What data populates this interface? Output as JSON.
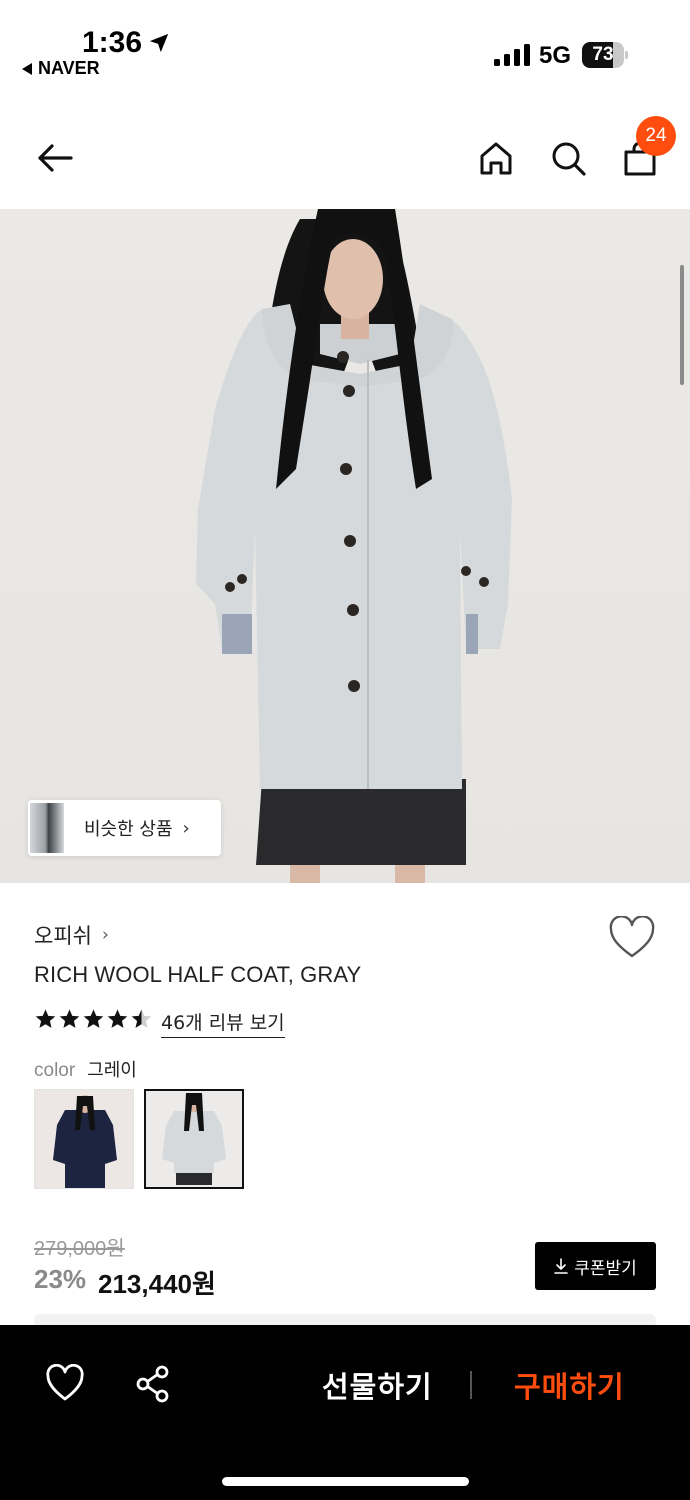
{
  "status_bar": {
    "time": "1:36",
    "back_app": "NAVER",
    "network": "5G",
    "battery": "73",
    "battery_level": 0.73
  },
  "nav": {
    "cart_count": "24"
  },
  "hero": {
    "similar_label": "비슷한 상품"
  },
  "product": {
    "brand": "오피쉬",
    "name": "RICH WOOL HALF COAT, GRAY",
    "rating": 4.5,
    "review_link": "46개 리뷰 보기",
    "color_label": "color",
    "color_value": "그레이",
    "swatch_colors": [
      "#1d2440",
      "#d6d9db"
    ]
  },
  "price": {
    "original": "279,000원",
    "discount": "23%",
    "final": "213,440원",
    "coupon_label": "쿠폰받기"
  },
  "bottom_bar": {
    "gift_label": "선물하기",
    "buy_label": "구매하기"
  },
  "colors": {
    "accent": "#ff4d0f",
    "dark": "#000000",
    "coat_gray": "#d6d9db"
  }
}
